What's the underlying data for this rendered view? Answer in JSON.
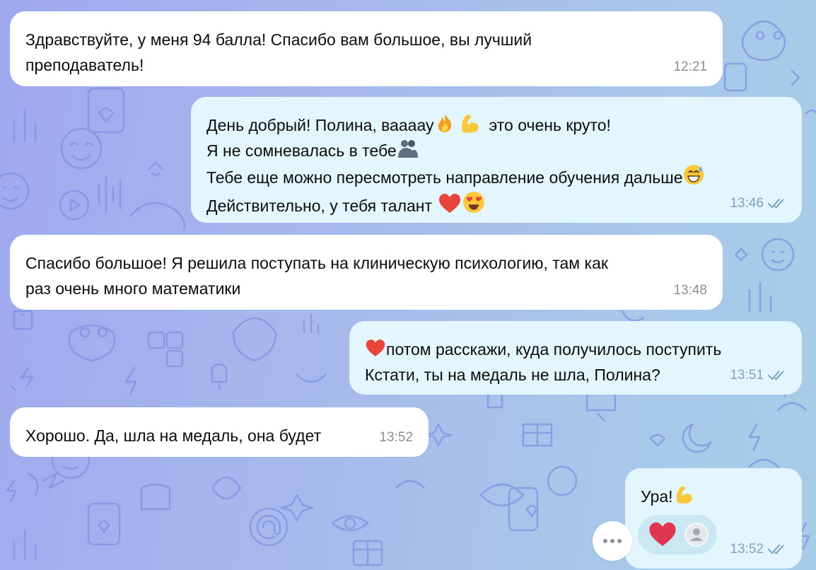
{
  "messages": [
    {
      "lines": [
        "Здравствуйте, у меня 94 балла! Спасибо вам большое, вы лучший",
        "преподаватель!"
      ],
      "time": "12:21",
      "direction": "incoming"
    },
    {
      "lines": [
        "День добрый! Полина, ваааау",
        "это очень круто!",
        "Я не сомневалась в тебе",
        "Тебе еще можно пересмотреть направление обучения дальше",
        "Действительно, у тебя талант"
      ],
      "time": "13:46",
      "direction": "outgoing",
      "status": "read"
    },
    {
      "lines": [
        "Спасибо большое! Я решила поступать на клиническую психологию, там как",
        "раз очень много математики"
      ],
      "time": "13:48",
      "direction": "incoming"
    },
    {
      "lines": [
        "потом расскажи, куда получилось поступить",
        "Кстати, ты на медаль не шла, Полина?"
      ],
      "time": "13:51",
      "direction": "outgoing",
      "status": "read"
    },
    {
      "lines": [
        "Хорошо. Да, шла на медаль, она будет"
      ],
      "time": "13:52",
      "direction": "incoming"
    },
    {
      "lines": [
        "Ура!"
      ],
      "time": "13:52",
      "direction": "outgoing",
      "status": "read",
      "reactions": [
        "red-heart",
        "user-avatar"
      ]
    }
  ],
  "colors": {
    "incoming_bubble": "#ffffff",
    "outgoing_bubble": "#e3f6fd",
    "outgoing_time": "#7ea3bd",
    "incoming_time": "#8c8f93",
    "wallpaper_start": "#9ea9ee",
    "wallpaper_end": "#a6cde8"
  },
  "icons": [
    "fire-emoji",
    "flexed-biceps-emoji",
    "hugging-people-emoji",
    "grinning-sweat-emoji",
    "red-heart-emoji",
    "heart-eyes-emoji",
    "double-check-icon",
    "more-dots-icon",
    "user-avatar-icon"
  ]
}
